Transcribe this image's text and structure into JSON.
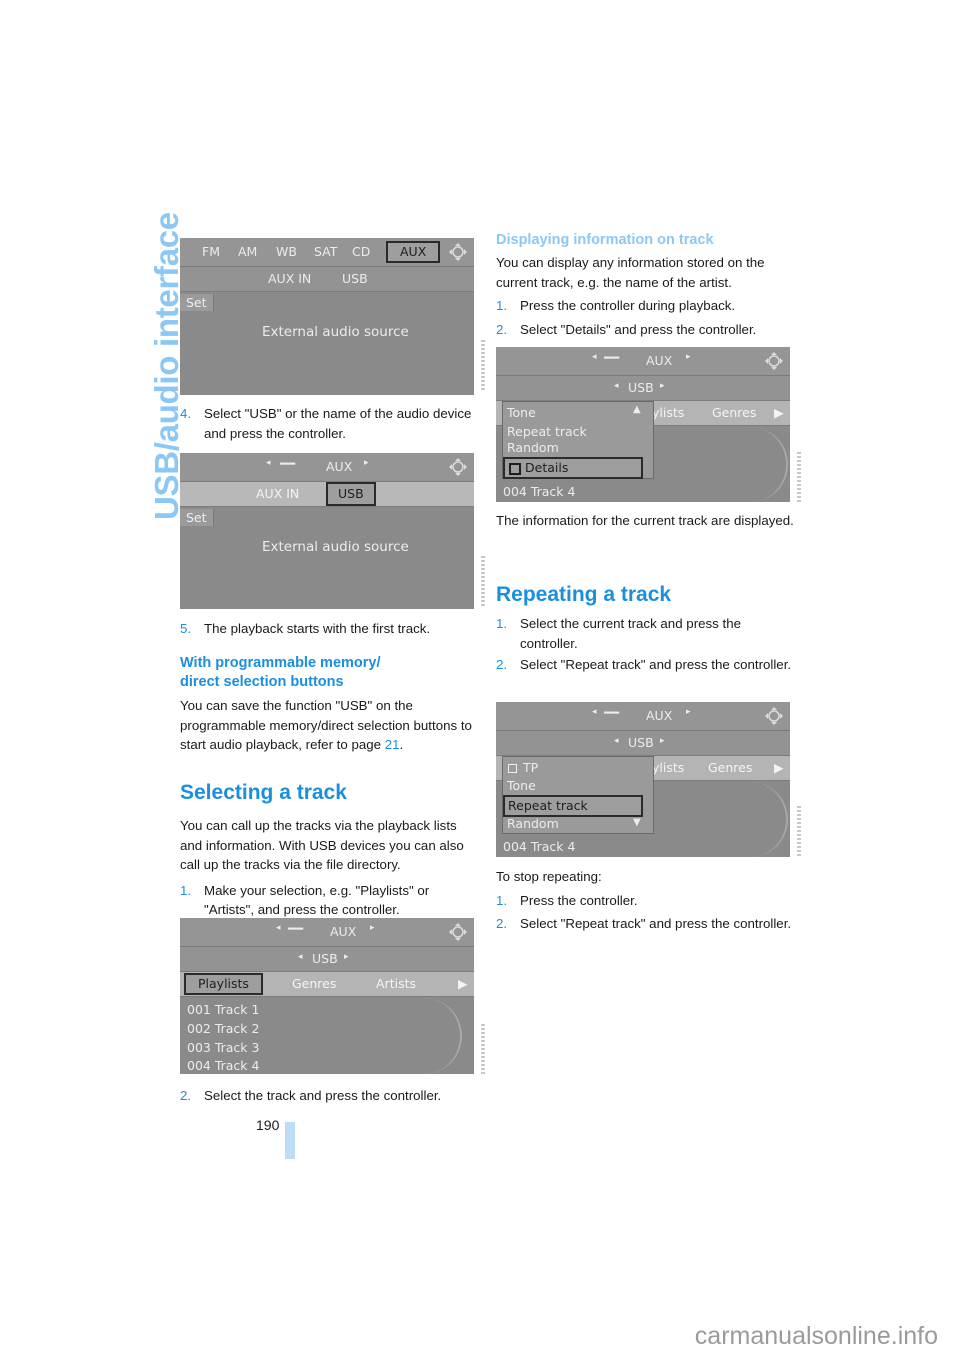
{
  "side_title": "USB/audio interface",
  "page_number": "190",
  "watermark": "carmanualsonline.info",
  "left_column": {
    "screen1": {
      "tabs": [
        "FM",
        "AM",
        "WB",
        "SAT",
        "CD",
        "AUX"
      ],
      "selected_tab": "AUX",
      "sub_items": [
        "AUX IN",
        "USB"
      ],
      "set_label": "Set",
      "message": "External audio source"
    },
    "step4": {
      "num": "4.",
      "text": "Select \"USB\" or the name of the audio device and press the controller."
    },
    "screen2": {
      "title": "AUX",
      "sub_items": [
        "AUX IN",
        "USB"
      ],
      "selected_sub": "USB",
      "set_label": "Set",
      "message": "External audio source"
    },
    "step5": {
      "num": "5.",
      "text": "The playback starts with the first track."
    },
    "prog_heading_line1": "With programmable memory/",
    "prog_heading_line2": "direct selection buttons",
    "prog_text_before": "You can save the function \"USB\" on the programmable memory/direct selection buttons to start audio playback, refer to page ",
    "prog_page_ref": "21",
    "prog_text_after": ".",
    "selecting_heading": "Selecting a track",
    "selecting_text": "You can call up the tracks via the playback lists and information. With USB devices you can also call up the tracks via the file directory.",
    "sel_step1": {
      "num": "1.",
      "text": "Make your selection, e.g. \"Playlists\" or \"Artists\", and press the controller."
    },
    "screen3": {
      "title": "AUX",
      "source": "USB",
      "tabs": [
        "Playlists",
        "Genres",
        "Artists"
      ],
      "selected_tab": "Playlists",
      "tracks": [
        "001 Track 1",
        "002 Track 2",
        "003 Track 3",
        "004 Track 4"
      ]
    },
    "sel_step2": {
      "num": "2.",
      "text": "Select the track and press the controller."
    }
  },
  "right_column": {
    "info_heading": "Displaying information on track",
    "info_text": "You can display any information stored on the current track, e.g. the name of the artist.",
    "info_step1": {
      "num": "1.",
      "text": "Press the controller during playback."
    },
    "info_step2": {
      "num": "2.",
      "text": "Select \"Details\" and press the controller."
    },
    "screen4": {
      "title": "AUX",
      "source": "USB",
      "tabs_visible": [
        "ylists",
        "Genres"
      ],
      "menu_items": [
        "Tone",
        "Repeat track",
        "Random",
        "Details"
      ],
      "selected_item": "Details",
      "current_track": "004 Track 4"
    },
    "info_result": "The information for the current track are displayed.",
    "repeat_heading": "Repeating a track",
    "rep_step1": {
      "num": "1.",
      "text": "Select the current track and press the controller."
    },
    "rep_step2": {
      "num": "2.",
      "text": "Select \"Repeat track\" and press the controller."
    },
    "screen5": {
      "title": "AUX",
      "source": "USB",
      "tabs_visible": [
        "ylists",
        "Genres"
      ],
      "menu_items": [
        "TP",
        "Tone",
        "Repeat track",
        "Random"
      ],
      "selected_item": "Repeat track",
      "current_track": "004 Track 4"
    },
    "stop_text": "To stop repeating:",
    "stop_step1": {
      "num": "1.",
      "text": "Press the controller."
    },
    "stop_step2": {
      "num": "2.",
      "text": "Select \"Repeat track\" and press the controller."
    }
  }
}
